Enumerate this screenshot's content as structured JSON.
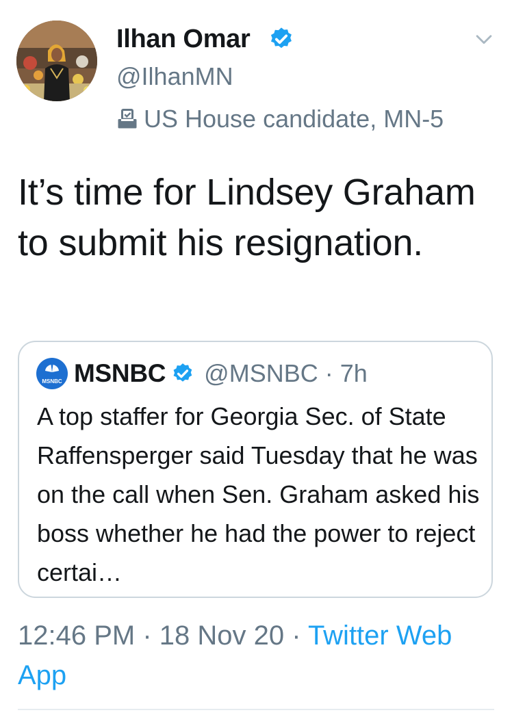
{
  "author": {
    "display_name": "Ilhan Omar",
    "handle": "@IlhanMN",
    "label": "US House candidate, MN-5",
    "verified": true
  },
  "tweet": {
    "text": "It’s time for Lindsey Graham to submit his resignation."
  },
  "quoted_tweet": {
    "display_name": "MSNBC",
    "handle_time": "@MSNBC · 7h",
    "logo_text": "MSNBC",
    "text": "A top staffer for Georgia Sec. of State Raffensperger said Tuesday that he was on the call when Sen. Graham asked his boss whether he had the power to reject certai…"
  },
  "meta": {
    "timestamp": "12:46 PM · 18 Nov 20 · ",
    "source": "Twitter Web App"
  },
  "icons": {
    "verified": "verified-badge-icon",
    "caret": "chevron-down-icon",
    "label": "ballot-box-icon"
  },
  "colors": {
    "accent": "#1da1f2",
    "secondary_text": "#657786",
    "border": "#ccd6dd"
  }
}
